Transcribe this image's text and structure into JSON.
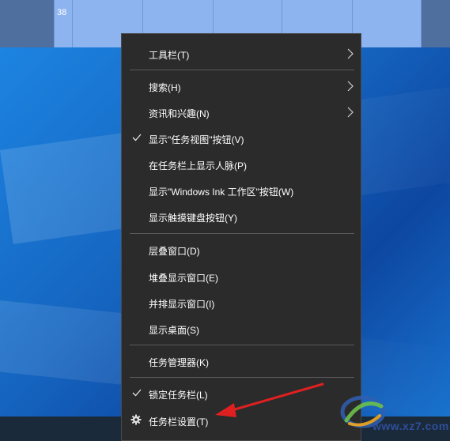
{
  "desktop": {
    "thumbnail_number": "38"
  },
  "context_menu": {
    "items": [
      {
        "id": "toolbars",
        "label": "工具栏(T)",
        "submenu": true,
        "checked": false
      },
      {
        "id": "search",
        "label": "搜索(H)",
        "submenu": true,
        "checked": false
      },
      {
        "id": "news",
        "label": "资讯和兴趣(N)",
        "submenu": true,
        "checked": false
      },
      {
        "id": "task-view",
        "label": "显示\"任务视图\"按钮(V)",
        "submenu": false,
        "checked": true
      },
      {
        "id": "people",
        "label": "在任务栏上显示人脉(P)",
        "submenu": false,
        "checked": false
      },
      {
        "id": "ink",
        "label": "显示\"Windows Ink 工作区\"按钮(W)",
        "submenu": false,
        "checked": false
      },
      {
        "id": "touch-keyboard",
        "label": "显示触摸键盘按钮(Y)",
        "submenu": false,
        "checked": false
      },
      {
        "id": "cascade",
        "label": "层叠窗口(D)",
        "submenu": false,
        "checked": false
      },
      {
        "id": "stacked",
        "label": "堆叠显示窗口(E)",
        "submenu": false,
        "checked": false
      },
      {
        "id": "side-by-side",
        "label": "并排显示窗口(I)",
        "submenu": false,
        "checked": false
      },
      {
        "id": "show-desktop",
        "label": "显示桌面(S)",
        "submenu": false,
        "checked": false
      },
      {
        "id": "task-manager",
        "label": "任务管理器(K)",
        "submenu": false,
        "checked": false
      },
      {
        "id": "lock-taskbar",
        "label": "锁定任务栏(L)",
        "submenu": false,
        "checked": true
      },
      {
        "id": "taskbar-settings",
        "label": "任务栏设置(T)",
        "submenu": false,
        "checked": false,
        "icon": "gear-icon"
      }
    ]
  },
  "annotation": {
    "arrow_color": "#e02020"
  },
  "watermark": {
    "text": "www.xz7.com"
  }
}
